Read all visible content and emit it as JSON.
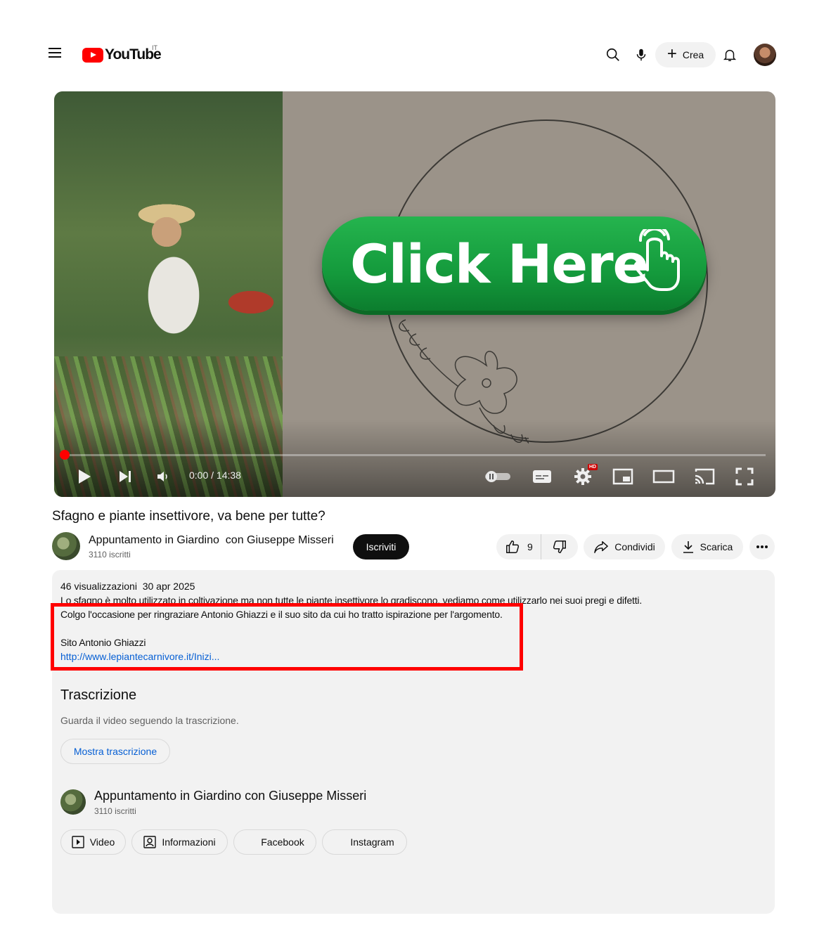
{
  "header": {
    "logo_text": "YouTube",
    "country_code": "IT",
    "create_label": "Crea",
    "icons": [
      "menu-icon",
      "search-icon",
      "mic-icon",
      "plus-icon",
      "bell-icon"
    ]
  },
  "player": {
    "overlay_text": "Click Here",
    "current_time": "0:00",
    "duration": "14:38",
    "time_display": "0:00 / 14:38",
    "progress_fraction": 0.0,
    "hd_badge": "HD",
    "accent_color": "#ff0000",
    "button_color": "#149a3c"
  },
  "video": {
    "title": "Sfagno e piante insettivore, va bene per tutte?",
    "channel_name": "Appuntamento in Giardino  con Giuseppe Misseri",
    "subscribers": "3110 iscritti",
    "subscribe_label": "Iscriviti",
    "like_count": "9",
    "share_label": "Condividi",
    "download_label": "Scarica"
  },
  "description": {
    "meta": "46 visualizzazioni  30 apr 2025",
    "line1": "Lo sfagno è molto utilizzato in coltivazione ma non tutte le piante insettivore lo gradiscono, vediamo come utilizzarlo nei suoi pregi e difetti.",
    "line2": "Colgo l'occasione per ringraziare Antonio Ghiazzi e il suo sito da cui ho tratto ispirazione per l'argomento.",
    "line3": "Sito Antonio Ghiazzi",
    "link": "http://www.lepiantecarnivore.it/Inizi...",
    "highlight_color": "#ff0000"
  },
  "transcript": {
    "title": "Trascrizione",
    "subtitle": "Guarda il video seguendo la trascrizione.",
    "button_label": "Mostra trascrizione"
  },
  "channel_card": {
    "name": "Appuntamento in Giardino con Giuseppe Misseri",
    "subscribers": "3110 iscritti",
    "links": [
      "Video",
      "Informazioni",
      "Facebook",
      "Instagram"
    ]
  }
}
